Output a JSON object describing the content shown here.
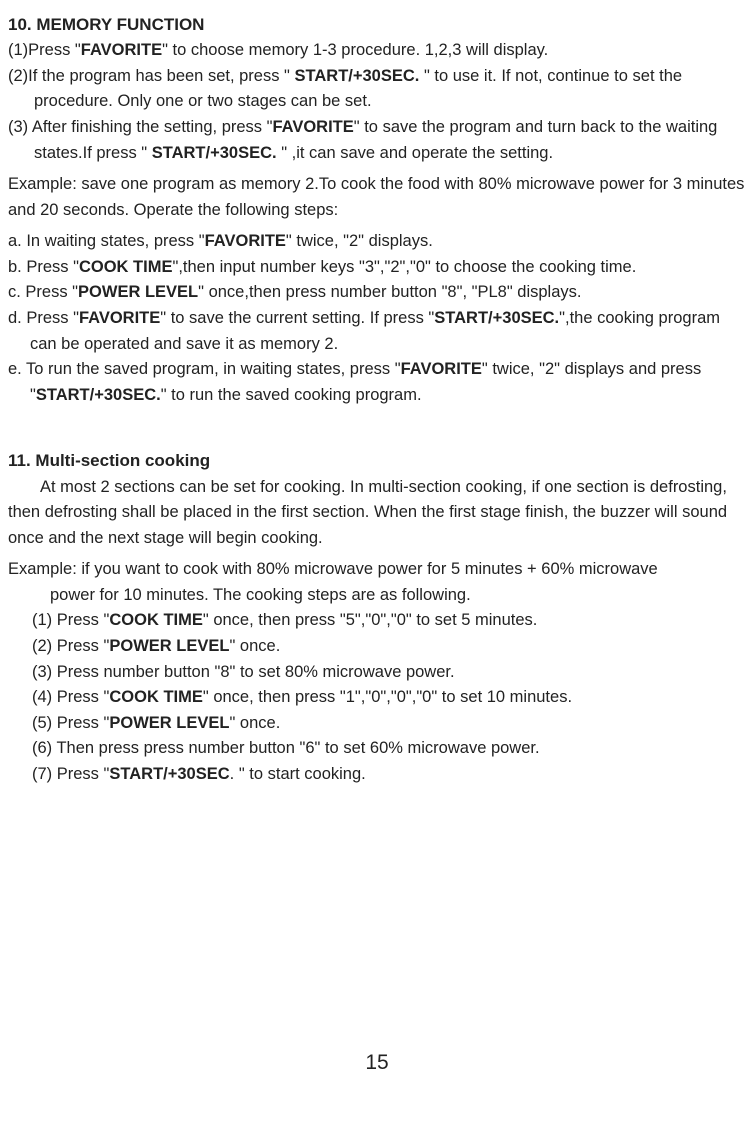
{
  "section10": {
    "title": "10. MEMORY FUNCTION",
    "items": [
      "(1)Press \"FAVORITE\" to choose memory 1-3 procedure. 1,2,3 will display.",
      "(2)If the program has been set, press \" START/+30SEC. \" to use it. If not, continue to set the procedure. Only one or two stages can be set.",
      "(3) After finishing the setting, press \"FAVORITE\" to save the program and turn back to the waiting states.If press \" START/+30SEC. \" ,it can save and operate the setting."
    ],
    "example_intro": " Example: save one program as memory 2.To cook the food with 80% microwave power for 3 minutes and 20 seconds. Operate the following steps:",
    "steps": [
      "a. In waiting states, press \"FAVORITE\" twice, \"2\" displays.",
      "b. Press \"COOK TIME\",then input number keys \"3\",\"2\",\"0\" to choose the cooking time.",
      "c. Press \"POWER LEVEL\" once,then press number button \"8\", \"PL8\" displays.",
      "d. Press \"FAVORITE\" to save the current setting. If press \"START/+30SEC.\",the cooking program can be operated and save it as memory 2.",
      "e. To run the saved program, in waiting states, press \"FAVORITE\" twice, \"2\" displays and press \"START/+30SEC.\" to run the saved cooking program."
    ]
  },
  "section11": {
    "title": "11. Multi-section cooking",
    "intro": "At most 2 sections can be set for cooking. In multi-section cooking, if one section is defrosting, then defrosting shall be placed in the first section. When the first stage finish, the buzzer will sound once and the next stage will begin cooking.",
    "example_intro": "Example: if you want to cook with 80% microwave power for 5 minutes + 60% microwave power for 10 minutes. The cooking steps are as following.",
    "steps": [
      "(1) Press \"COOK TIME\" once, then press \"5\",\"0\",\"0\" to set 5 minutes.",
      "(2) Press \"POWER LEVEL\" once.",
      "(3) Press number button \"8\" to set 80% microwave power.",
      "(4) Press \"COOK TIME\" once, then press \"1\",\"0\",\"0\",\"0\" to set 10 minutes.",
      "(5) Press \"POWER LEVEL\" once.",
      "(6) Then press press number button \"6\" to set 60% microwave power.",
      "(7) Press \"START/+30SEC. \" to start cooking."
    ]
  },
  "page_number": "15"
}
